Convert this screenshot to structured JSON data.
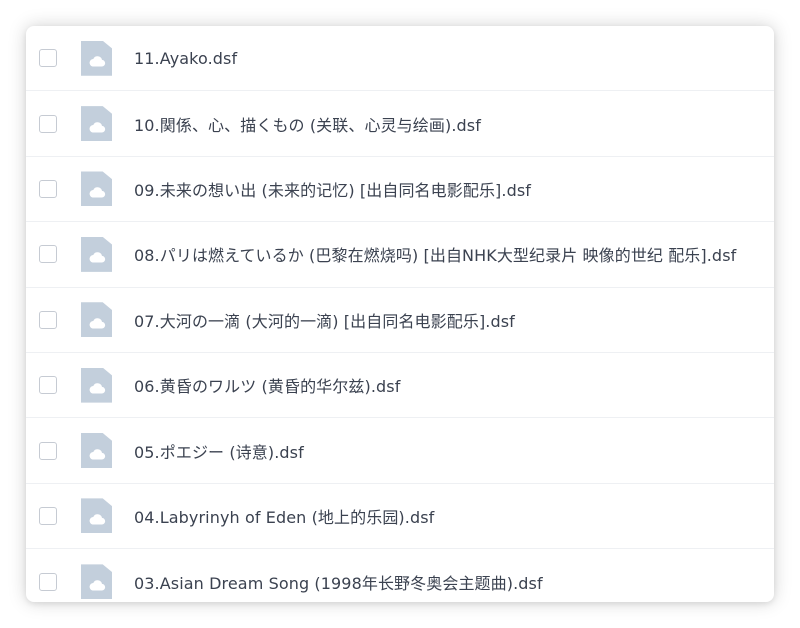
{
  "file_list": {
    "icon": "cloud-file-icon",
    "colors": {
      "icon_fill": "#c3cfdc",
      "text": "#3b4250",
      "divider": "#eef0f3",
      "checkbox_border": "#c6cbd3"
    },
    "items": [
      {
        "name": "11.Ayako.dsf"
      },
      {
        "name": "10.関係、心、描くもの (关联、心灵与绘画).dsf"
      },
      {
        "name": "09.未来の想い出 (未来的记忆) [出自同名电影配乐].dsf"
      },
      {
        "name": "08.パリは燃えているか (巴黎在燃烧吗) [出自NHK大型纪录片 映像的世纪 配乐].dsf"
      },
      {
        "name": "07.大河の一滴 (大河的一滴) [出自同名电影配乐].dsf"
      },
      {
        "name": "06.黄昏のワルツ (黄昏的华尔兹).dsf"
      },
      {
        "name": "05.ポエジー (诗意).dsf"
      },
      {
        "name": "04.Labyrinyh of Eden (地上的乐园).dsf"
      },
      {
        "name": "03.Asian Dream Song (1998年长野冬奥会主题曲).dsf"
      }
    ]
  }
}
